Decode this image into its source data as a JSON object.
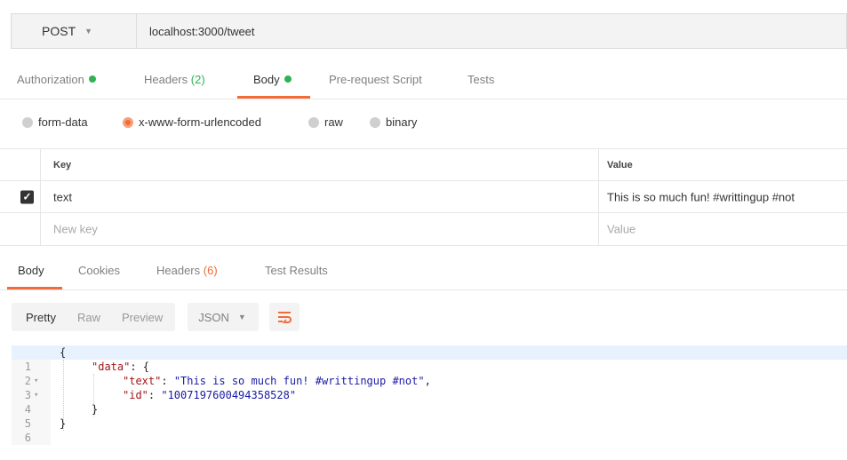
{
  "request": {
    "method": "POST",
    "url": "localhost:3000/tweet"
  },
  "request_tabs": [
    {
      "label": "Authorization",
      "dot": true
    },
    {
      "label": "Headers",
      "count": "(2)"
    },
    {
      "label": "Body",
      "dot": true,
      "active": true
    },
    {
      "label": "Pre-request Script"
    },
    {
      "label": "Tests"
    }
  ],
  "body_modes": [
    {
      "label": "form-data",
      "selected": false
    },
    {
      "label": "x-www-form-urlencoded",
      "selected": true
    },
    {
      "label": "raw",
      "selected": false
    },
    {
      "label": "binary",
      "selected": false
    }
  ],
  "params": {
    "key_header": "Key",
    "value_header": "Value",
    "rows": [
      {
        "checked": true,
        "key": "text",
        "value": "This is so much fun! #writtingup #not"
      }
    ],
    "new_key_placeholder": "New key",
    "new_value_placeholder": "Value"
  },
  "response_tabs": [
    {
      "label": "Body",
      "active": true
    },
    {
      "label": "Cookies"
    },
    {
      "label": "Headers",
      "count": "(6)"
    },
    {
      "label": "Test Results"
    }
  ],
  "view_modes": [
    "Pretty",
    "Raw",
    "Preview"
  ],
  "active_view_mode": "Pretty",
  "format": "JSON",
  "code_lines": [
    {
      "num": "1",
      "fold": true,
      "text": "{"
    },
    {
      "num": "2",
      "fold": true,
      "key": "\"data\"",
      "rest": ": {"
    },
    {
      "num": "3",
      "key": "\"text\"",
      "sep": ": ",
      "str": "\"This is so much fun! #writtingup #not\"",
      "tail": ","
    },
    {
      "num": "4",
      "key": "\"id\"",
      "sep": ": ",
      "str": "\"1007197600494358528\"",
      "tail": ""
    },
    {
      "num": "5",
      "text": "}"
    },
    {
      "num": "6",
      "text": "}"
    }
  ],
  "colors": {
    "accent": "#f26b3a",
    "status_green": "#2fb351"
  }
}
